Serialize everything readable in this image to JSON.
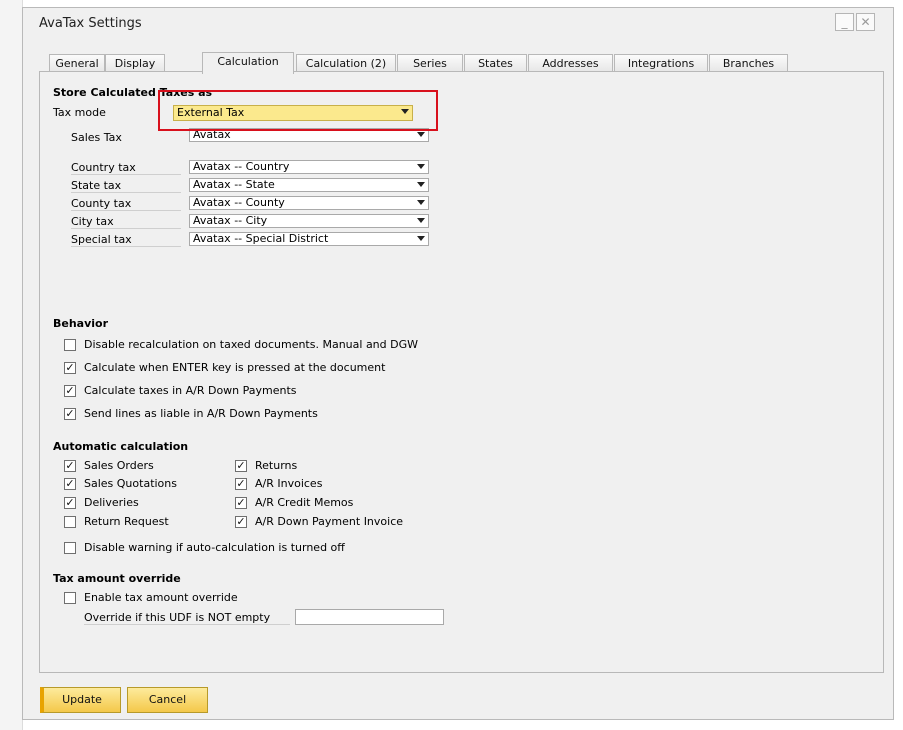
{
  "window": {
    "title": "AvaTax Settings",
    "minimize_glyph": "_",
    "close_glyph": "✕"
  },
  "tabs": [
    "General",
    "Display",
    "Calculation",
    "Calculation (2)",
    "Series",
    "States",
    "Addresses",
    "Integrations",
    "Branches"
  ],
  "active_tab": "Calculation",
  "store": {
    "heading": "Store Calculated Taxes as",
    "tax_mode_label": "Tax mode",
    "tax_mode_value": "External Tax",
    "sales_tax_label": "Sales Tax",
    "sales_tax_value": "Avatax"
  },
  "tax_rows": [
    {
      "label": "Country tax",
      "value": "Avatax -- Country"
    },
    {
      "label": "State tax",
      "value": "Avatax -- State"
    },
    {
      "label": "County tax",
      "value": "Avatax -- County"
    },
    {
      "label": "City tax",
      "value": "Avatax -- City"
    },
    {
      "label": "Special tax",
      "value": "Avatax -- Special District"
    }
  ],
  "behavior": {
    "heading": "Behavior",
    "items": [
      {
        "label": "Disable recalculation on taxed documents. Manual and DGW",
        "checked": false
      },
      {
        "label": "Calculate when ENTER key is pressed at the document",
        "checked": true
      },
      {
        "label": "Calculate taxes in A/R Down Payments",
        "checked": true
      },
      {
        "label": "Send lines as liable in A/R Down Payments",
        "checked": true
      }
    ]
  },
  "auto": {
    "heading": "Automatic calculation",
    "left": [
      {
        "label": "Sales Orders",
        "checked": true
      },
      {
        "label": "Sales Quotations",
        "checked": true
      },
      {
        "label": "Deliveries",
        "checked": true
      },
      {
        "label": "Return Request",
        "checked": false
      }
    ],
    "right": [
      {
        "label": "Returns",
        "checked": true
      },
      {
        "label": "A/R Invoices",
        "checked": true
      },
      {
        "label": "A/R Credit Memos",
        "checked": true
      },
      {
        "label": "A/R Down Payment Invoice",
        "checked": true
      }
    ],
    "disable_warning": {
      "label": "Disable warning if auto-calculation is turned off",
      "checked": false
    }
  },
  "override": {
    "heading": "Tax amount override",
    "enable": {
      "label": "Enable tax amount override",
      "checked": false
    },
    "udf_label": "Override if this UDF is NOT empty",
    "udf_value": ""
  },
  "buttons": {
    "update": "Update",
    "cancel": "Cancel"
  },
  "colors": {
    "highlight": "#d8101c",
    "tax_mode_bg": "#fbe98d",
    "button_bg": "#f4c84a"
  },
  "icons": {
    "dropdown": "chevron-down-icon",
    "check": "checkmark-icon"
  }
}
